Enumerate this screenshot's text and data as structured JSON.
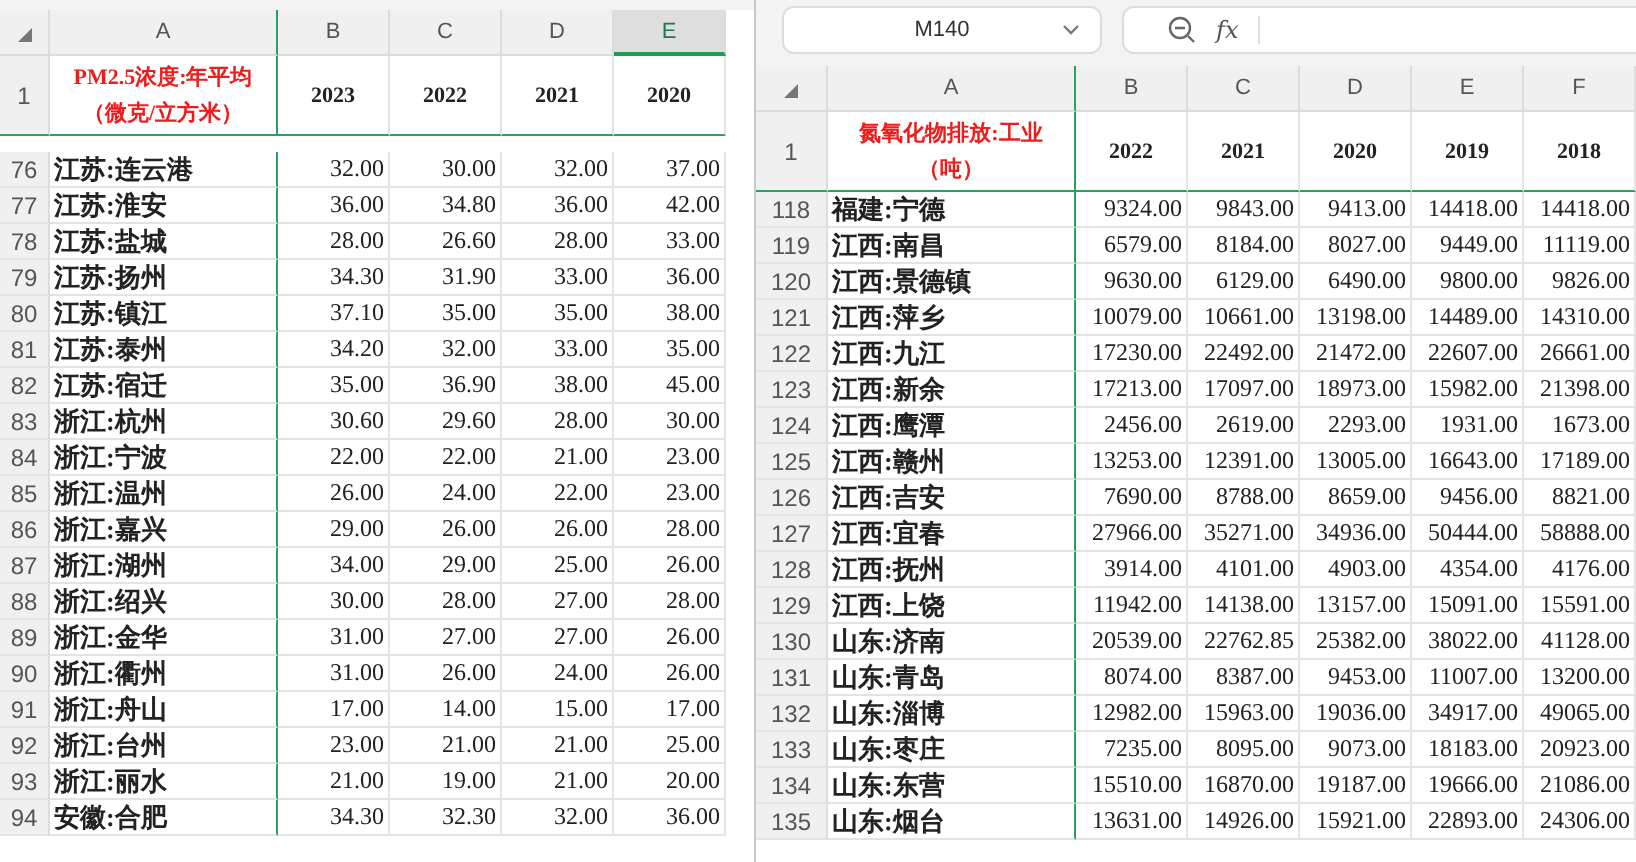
{
  "left_sheet": {
    "columns": [
      {
        "label": "A",
        "selected": false
      },
      {
        "label": "B",
        "selected": false
      },
      {
        "label": "C",
        "selected": false
      },
      {
        "label": "D",
        "selected": false
      },
      {
        "label": "E",
        "selected": true
      }
    ],
    "header_row": {
      "number": "1",
      "title_lines": [
        "PM2.5浓度:年平均",
        "（微克/立方米）"
      ],
      "cells": [
        "2023",
        "2022",
        "2021",
        "2020"
      ]
    },
    "rows": [
      {
        "number": "76",
        "cells": [
          "江苏:连云港",
          "32.00",
          "30.00",
          "32.00",
          "37.00"
        ]
      },
      {
        "number": "77",
        "cells": [
          "江苏:淮安",
          "36.00",
          "34.80",
          "36.00",
          "42.00"
        ]
      },
      {
        "number": "78",
        "cells": [
          "江苏:盐城",
          "28.00",
          "26.60",
          "28.00",
          "33.00"
        ]
      },
      {
        "number": "79",
        "cells": [
          "江苏:扬州",
          "34.30",
          "31.90",
          "33.00",
          "36.00"
        ]
      },
      {
        "number": "80",
        "cells": [
          "江苏:镇江",
          "37.10",
          "35.00",
          "35.00",
          "38.00"
        ]
      },
      {
        "number": "81",
        "cells": [
          "江苏:泰州",
          "34.20",
          "32.00",
          "33.00",
          "35.00"
        ]
      },
      {
        "number": "82",
        "cells": [
          "江苏:宿迁",
          "35.00",
          "36.90",
          "38.00",
          "45.00"
        ]
      },
      {
        "number": "83",
        "cells": [
          "浙江:杭州",
          "30.60",
          "29.60",
          "28.00",
          "30.00"
        ]
      },
      {
        "number": "84",
        "cells": [
          "浙江:宁波",
          "22.00",
          "22.00",
          "21.00",
          "23.00"
        ]
      },
      {
        "number": "85",
        "cells": [
          "浙江:温州",
          "26.00",
          "24.00",
          "22.00",
          "23.00"
        ]
      },
      {
        "number": "86",
        "cells": [
          "浙江:嘉兴",
          "29.00",
          "26.00",
          "26.00",
          "28.00"
        ]
      },
      {
        "number": "87",
        "cells": [
          "浙江:湖州",
          "34.00",
          "29.00",
          "25.00",
          "26.00"
        ]
      },
      {
        "number": "88",
        "cells": [
          "浙江:绍兴",
          "30.00",
          "28.00",
          "27.00",
          "28.00"
        ]
      },
      {
        "number": "89",
        "cells": [
          "浙江:金华",
          "31.00",
          "27.00",
          "27.00",
          "26.00"
        ]
      },
      {
        "number": "90",
        "cells": [
          "浙江:衢州",
          "31.00",
          "26.00",
          "24.00",
          "26.00"
        ]
      },
      {
        "number": "91",
        "cells": [
          "浙江:舟山",
          "17.00",
          "14.00",
          "15.00",
          "17.00"
        ]
      },
      {
        "number": "92",
        "cells": [
          "浙江:台州",
          "23.00",
          "21.00",
          "21.00",
          "25.00"
        ]
      },
      {
        "number": "93",
        "cells": [
          "浙江:丽水",
          "21.00",
          "19.00",
          "21.00",
          "20.00"
        ]
      },
      {
        "number": "94",
        "cells": [
          "安徽:合肥",
          "34.30",
          "32.30",
          "32.00",
          "36.00"
        ]
      }
    ]
  },
  "right_sheet": {
    "name_box": "M140",
    "formula_label": "fx",
    "columns": [
      {
        "label": "A",
        "selected": false
      },
      {
        "label": "B",
        "selected": false
      },
      {
        "label": "C",
        "selected": false
      },
      {
        "label": "D",
        "selected": false
      },
      {
        "label": "E",
        "selected": false
      },
      {
        "label": "F",
        "selected": false
      }
    ],
    "header_row": {
      "number": "1",
      "title_lines": [
        "氮氧化物排放:工业",
        "（吨）"
      ],
      "cells": [
        "2022",
        "2021",
        "2020",
        "2019",
        "2018"
      ]
    },
    "rows": [
      {
        "number": "118",
        "cells": [
          "福建:宁德",
          "9324.00",
          "9843.00",
          "9413.00",
          "14418.00",
          "14418.00"
        ]
      },
      {
        "number": "119",
        "cells": [
          "江西:南昌",
          "6579.00",
          "8184.00",
          "8027.00",
          "9449.00",
          "11119.00"
        ]
      },
      {
        "number": "120",
        "cells": [
          "江西:景德镇",
          "9630.00",
          "6129.00",
          "6490.00",
          "9800.00",
          "9826.00"
        ]
      },
      {
        "number": "121",
        "cells": [
          "江西:萍乡",
          "10079.00",
          "10661.00",
          "13198.00",
          "14489.00",
          "14310.00"
        ]
      },
      {
        "number": "122",
        "cells": [
          "江西:九江",
          "17230.00",
          "22492.00",
          "21472.00",
          "22607.00",
          "26661.00"
        ]
      },
      {
        "number": "123",
        "cells": [
          "江西:新余",
          "17213.00",
          "17097.00",
          "18973.00",
          "15982.00",
          "21398.00"
        ]
      },
      {
        "number": "124",
        "cells": [
          "江西:鹰潭",
          "2456.00",
          "2619.00",
          "2293.00",
          "1931.00",
          "1673.00"
        ]
      },
      {
        "number": "125",
        "cells": [
          "江西:赣州",
          "13253.00",
          "12391.00",
          "13005.00",
          "16643.00",
          "17189.00"
        ]
      },
      {
        "number": "126",
        "cells": [
          "江西:吉安",
          "7690.00",
          "8788.00",
          "8659.00",
          "9456.00",
          "8821.00"
        ]
      },
      {
        "number": "127",
        "cells": [
          "江西:宜春",
          "27966.00",
          "35271.00",
          "34936.00",
          "50444.00",
          "58888.00"
        ]
      },
      {
        "number": "128",
        "cells": [
          "江西:抚州",
          "3914.00",
          "4101.00",
          "4903.00",
          "4354.00",
          "4176.00"
        ]
      },
      {
        "number": "129",
        "cells": [
          "江西:上饶",
          "11942.00",
          "14138.00",
          "13157.00",
          "15091.00",
          "15591.00"
        ]
      },
      {
        "number": "130",
        "cells": [
          "山东:济南",
          "20539.00",
          "22762.85",
          "25382.00",
          "38022.00",
          "41128.00"
        ]
      },
      {
        "number": "131",
        "cells": [
          "山东:青岛",
          "8074.00",
          "8387.00",
          "9453.00",
          "11007.00",
          "13200.00"
        ]
      },
      {
        "number": "132",
        "cells": [
          "山东:淄博",
          "12982.00",
          "15963.00",
          "19036.00",
          "34917.00",
          "49065.00"
        ]
      },
      {
        "number": "133",
        "cells": [
          "山东:枣庄",
          "7235.00",
          "8095.00",
          "9073.00",
          "18183.00",
          "20923.00"
        ]
      },
      {
        "number": "134",
        "cells": [
          "山东:东营",
          "15510.00",
          "16870.00",
          "19187.00",
          "19666.00",
          "21086.00"
        ]
      },
      {
        "number": "135",
        "cells": [
          "山东:烟台",
          "13631.00",
          "14926.00",
          "15921.00",
          "22893.00",
          "24306.00"
        ]
      }
    ]
  }
}
